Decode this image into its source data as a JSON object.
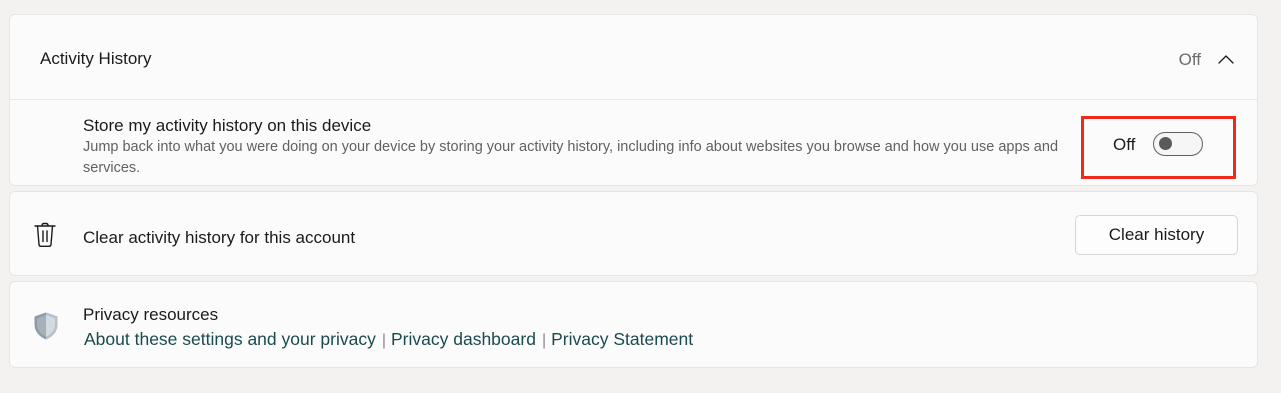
{
  "activity_history": {
    "title": "Activity History",
    "state": "Off",
    "chevron_icon": "chevron-up-icon",
    "store_setting": {
      "title": "Store my activity history on this device",
      "description": "Jump back into what you were doing on your device by storing your activity history, including info about websites you browse and how you use apps and services.",
      "toggle_label": "Off",
      "toggle_on": false
    },
    "highlight_color": "#ee2a1a"
  },
  "clear_history": {
    "icon": "trash-icon",
    "label": "Clear activity history for this account",
    "button_label": "Clear history"
  },
  "privacy_resources": {
    "icon": "shield-icon",
    "title": "Privacy resources",
    "links": [
      "About these settings and your privacy",
      "Privacy dashboard",
      "Privacy Statement"
    ],
    "separator": "|"
  }
}
